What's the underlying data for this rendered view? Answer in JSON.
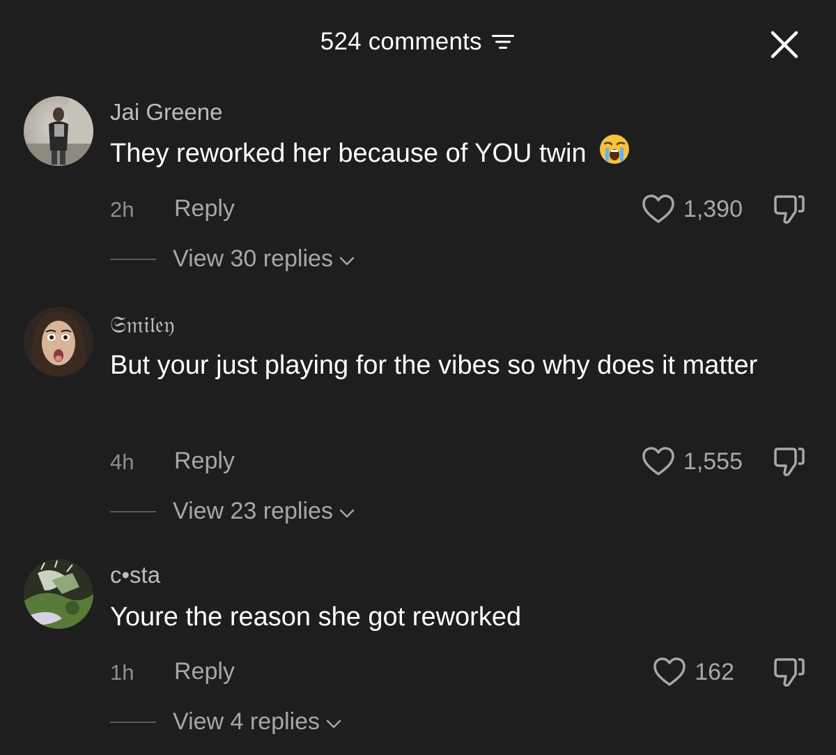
{
  "header": {
    "title": "524 comments",
    "sort_icon": "sort-lines-icon",
    "close_icon": "close-icon"
  },
  "colors": {
    "background": "#1e1e1e",
    "primary_text": "#ffffff",
    "secondary_text": "#a8a8a8",
    "username_text": "#bdbdbd",
    "divider": "#5c5c5c"
  },
  "comments": [
    {
      "username": "Jai Greene",
      "text": "They reworked her because of YOU twin",
      "emoji": "loudly-crying-face",
      "time": "2h",
      "reply_label": "Reply",
      "likes": "1,390",
      "view_replies": "View 30 replies"
    },
    {
      "username": "𝔖𝔪𝔦𝔩𝔢𝔶",
      "text": "But your just playing for the vibes so why does it matter",
      "time": "4h",
      "reply_label": "Reply",
      "likes": "1,555",
      "view_replies": "View 23 replies"
    },
    {
      "username": "c•sta",
      "text": "Youre the reason she got reworked",
      "time": "1h",
      "reply_label": "Reply",
      "likes": "162",
      "view_replies": "View 4 replies"
    }
  ]
}
